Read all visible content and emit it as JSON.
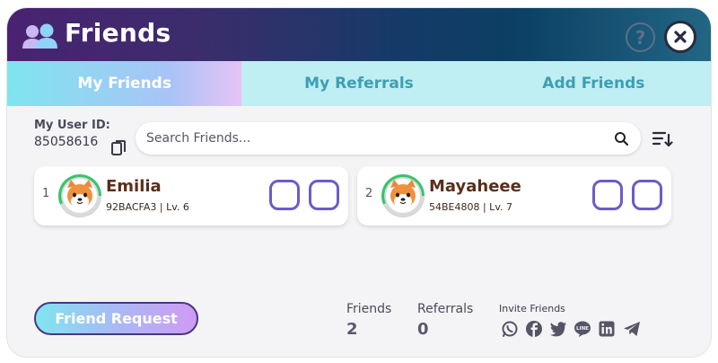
{
  "header": {
    "title": "Friends",
    "help_label": "?"
  },
  "tabs": [
    {
      "label": "My Friends",
      "active": true
    },
    {
      "label": "My Referrals",
      "active": false
    },
    {
      "label": "Add Friends",
      "active": false
    }
  ],
  "user": {
    "id_label": "My User ID:",
    "id_value": "85058616"
  },
  "search": {
    "placeholder": "Search Friends..."
  },
  "friends": [
    {
      "rank": "1",
      "name": "Emilia",
      "meta": "92BACFA3 | Lv. 6"
    },
    {
      "rank": "2",
      "name": "Mayaheee",
      "meta": "54BE4808 | Lv. 7"
    }
  ],
  "footer": {
    "request_button": "Friend Request",
    "friends_label": "Friends",
    "friends_count": "2",
    "referrals_label": "Referrals",
    "referrals_count": "0",
    "invite_label": "Invite Friends",
    "social_icons": [
      "whatsapp-icon",
      "facebook-icon",
      "twitter-icon",
      "line-icon",
      "linkedin-icon",
      "telegram-icon"
    ]
  },
  "colors": {
    "header_start": "#4a2272",
    "header_end": "#226684",
    "tab_active_start": "#7fe5ee",
    "tab_active_end": "#e7c3f6",
    "tab_inactive_bg": "#bfeef3",
    "tab_inactive_text": "#3d9fb2",
    "slot_border": "#6b5cc9",
    "name_color": "#5a2e1a"
  }
}
